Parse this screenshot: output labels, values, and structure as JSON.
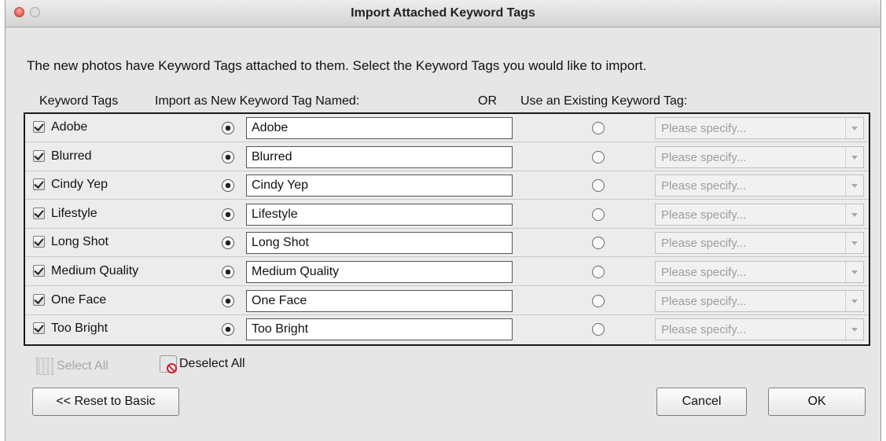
{
  "window": {
    "title": "Import Attached Keyword Tags"
  },
  "instruction": "The new photos have Keyword Tags attached to them.  Select the Keyword Tags you would like to import.",
  "headers": {
    "keyword_tags": "Keyword Tags",
    "import_as": "Import as New Keyword Tag Named:",
    "or": "OR",
    "use_existing": "Use an Existing Keyword Tag:"
  },
  "rows": [
    {
      "tag": "Adobe",
      "checked": true,
      "new_name": "Adobe",
      "mode": "new",
      "existing_placeholder": "Please specify..."
    },
    {
      "tag": "Blurred",
      "checked": true,
      "new_name": "Blurred",
      "mode": "new",
      "existing_placeholder": "Please specify..."
    },
    {
      "tag": "Cindy Yep",
      "checked": true,
      "new_name": "Cindy Yep",
      "mode": "new",
      "existing_placeholder": "Please specify..."
    },
    {
      "tag": "Lifestyle",
      "checked": true,
      "new_name": "Lifestyle",
      "mode": "new",
      "existing_placeholder": "Please specify..."
    },
    {
      "tag": "Long Shot",
      "checked": true,
      "new_name": "Long Shot",
      "mode": "new",
      "existing_placeholder": "Please specify..."
    },
    {
      "tag": "Medium Quality",
      "checked": true,
      "new_name": "Medium Quality",
      "mode": "new",
      "existing_placeholder": "Please specify..."
    },
    {
      "tag": "One Face",
      "checked": true,
      "new_name": "One Face",
      "mode": "new",
      "existing_placeholder": "Please specify..."
    },
    {
      "tag": "Too Bright",
      "checked": true,
      "new_name": "Too Bright",
      "mode": "new",
      "existing_placeholder": "Please specify..."
    }
  ],
  "actions": {
    "select_all": "Select All",
    "deselect_all": "Deselect All",
    "reset_to_basic": "<< Reset to Basic",
    "cancel": "Cancel",
    "ok": "OK"
  }
}
